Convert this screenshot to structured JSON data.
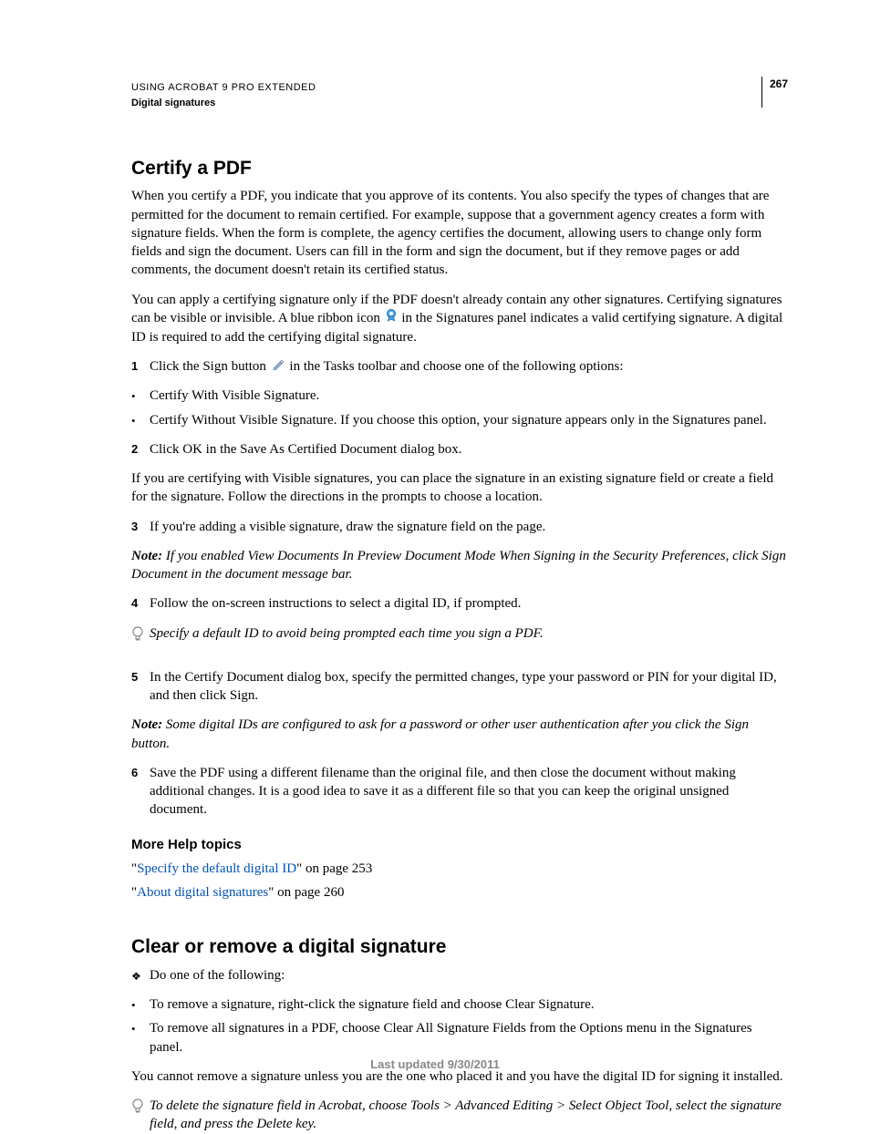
{
  "header": {
    "title": "USING ACROBAT 9 PRO EXTENDED",
    "subtitle": "Digital signatures",
    "page_number": "267"
  },
  "section1": {
    "heading": "Certify a PDF",
    "p1": "When you certify a PDF, you indicate that you approve of its contents. You also specify the types of changes that are permitted for the document to remain certified. For example, suppose that a government agency creates a form with signature fields. When the form is complete, the agency certifies the document, allowing users to change only form fields and sign the document. Users can fill in the form and sign the document, but if they remove pages or add comments, the document doesn't retain its certified status.",
    "p2a": "You can apply a certifying signature only if the PDF doesn't already contain any other signatures. Certifying signatures can be visible or invisible. A blue ribbon icon ",
    "p2b": " in the Signatures panel indicates a valid certifying signature. A digital ID is required to add the certifying digital signature.",
    "step1a": "Click the Sign button ",
    "step1b": " in the Tasks toolbar and choose one of the following options:",
    "bullet1": "Certify With Visible Signature.",
    "bullet2": "Certify Without Visible Signature. If you choose this option, your signature appears only in the Signatures panel.",
    "step2": "Click OK in the Save As Certified Document dialog box.",
    "p3": "If you are certifying with Visible signatures, you can place the signature in an existing signature field or create a field for the signature. Follow the directions in the prompts to choose a location.",
    "step3": "If you're adding a visible signature, draw the signature field on the page.",
    "note1_label": "Note: ",
    "note1_body": "If you enabled View Documents In Preview Document Mode When Signing in the Security Preferences, click Sign Document in the document message bar.",
    "step4": "Follow the on-screen instructions to select a digital ID, if prompted.",
    "tip1": "Specify a default ID to avoid being prompted each time you sign a PDF.",
    "step5": "In the Certify Document dialog box, specify the permitted changes, type your password or PIN for your digital ID, and then click Sign.",
    "note2_label": "Note: ",
    "note2_body": "Some digital IDs are configured to ask for a password or other user authentication after you click the Sign button.",
    "step6": "Save the PDF using a different filename than the original file, and then close the document without making additional changes. It is a good idea to save it as a different file so that you can keep the original unsigned document."
  },
  "morehelp": {
    "heading": "More Help topics",
    "link1_text": "Specify the default digital ID",
    "link1_suffix": "\" on page 253",
    "link2_text": "About digital signatures",
    "link2_suffix": "\" on page 260"
  },
  "section2": {
    "heading": "Clear or remove a digital signature",
    "diamond1": "Do one of the following:",
    "bullet1": "To remove a signature, right-click the signature field and choose Clear Signature.",
    "bullet2": "To remove all signatures in a PDF, choose Clear All Signature Fields from the Options menu in the Signatures panel.",
    "p1": "You cannot remove a signature unless you are the one who placed it and you have the digital ID for signing it installed.",
    "tip1": "To delete the signature field in Acrobat, choose Tools > Advanced Editing > Select Object Tool, select the signature field, and press the Delete key."
  },
  "footer": {
    "text": "Last updated 9/30/2011"
  }
}
